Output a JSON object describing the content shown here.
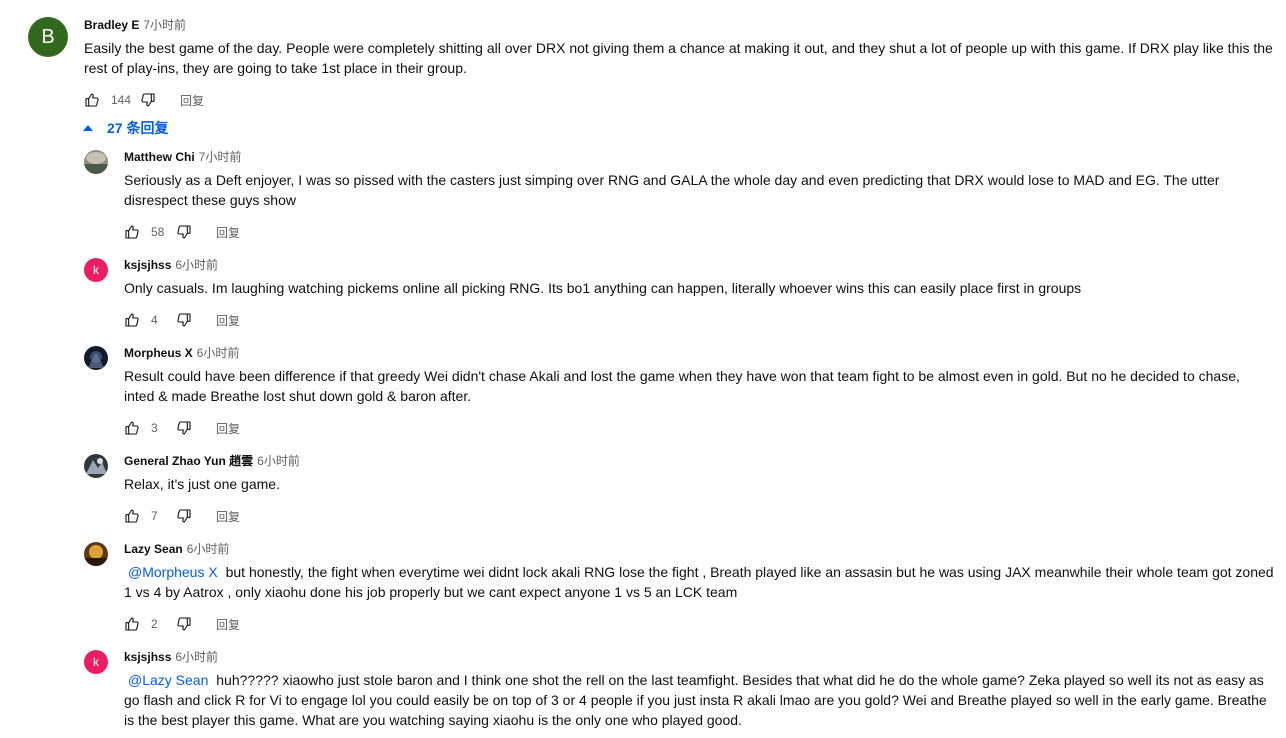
{
  "main_comment": {
    "avatar_letter": "B",
    "avatar_color": "#33691e",
    "author": "Bradley E",
    "time": "7小时前",
    "text": "Easily the best game of the day. People were completely shitting all over DRX not giving them a chance at making it out, and they shut a lot of people up with this game. If DRX play like this the rest of play-ins, they are going to take 1st place in their group.",
    "likes": "144",
    "reply_label": "回复"
  },
  "replies_toggle": {
    "label": "27 条回复"
  },
  "replies": [
    {
      "author": "Matthew Chi",
      "time": "7小时前",
      "mention": "",
      "text": "Seriously as a Deft enjoyer, I was so pissed with the casters just simping over RNG and GALA the whole day and even predicting that DRX would lose to MAD and EG. The utter disrespect these guys show",
      "likes": "58",
      "reply_label": "回复"
    },
    {
      "author": "ksjsjhss",
      "avatar_letter": "k",
      "avatar_color": "#e91e63",
      "time": "6小时前",
      "mention": "",
      "text": "Only casuals. Im laughing watching pickems online all picking RNG. Its bo1 anything can happen, literally whoever wins this can easily place first in groups",
      "likes": "4",
      "reply_label": "回复"
    },
    {
      "author": "Morpheus X",
      "time": "6小时前",
      "mention": "",
      "text": "Result could have been difference if that greedy Wei didn't chase Akali and lost the game when they have won that team fight to be almost even in gold. But no he decided to chase, inted & made Breathe lost shut down gold & baron after.",
      "likes": "3",
      "reply_label": "回复"
    },
    {
      "author": "General Zhao Yun 趙雲",
      "time": "6小时前",
      "mention": "",
      "text": "Relax, it's just one game.",
      "likes": "7",
      "reply_label": "回复"
    },
    {
      "author": "Lazy Sean",
      "time": "6小时前",
      "mention": "@Morpheus X",
      "text": "but honestly, the fight when everytime wei didnt lock akali RNG lose the fight , Breath played like an assasin but he was using JAX meanwhile their whole team got zoned 1 vs 4 by Aatrox , only xiaohu done his job properly but we cant expect anyone 1 vs 5 an LCK team",
      "likes": "2",
      "reply_label": "回复"
    },
    {
      "author": "ksjsjhss",
      "avatar_letter": "k",
      "avatar_color": "#e91e63",
      "time": "6小时前",
      "mention": "@Lazy Sean",
      "text": "huh????? xiaowho just stole baron and I think one shot the rell on the last teamfight. Besides that what did he do the whole game? Zeka played so well its not as easy as go flash and click R for Vi to engage lol you could easily be on top of 3 or 4 people if you just insta R akali lmao are you gold? Wei and Breathe played so well in the early game. Breathe is the best player this game. What are you watching saying xiaohu is the only one who played good.",
      "likes": "",
      "reply_label": ""
    }
  ]
}
